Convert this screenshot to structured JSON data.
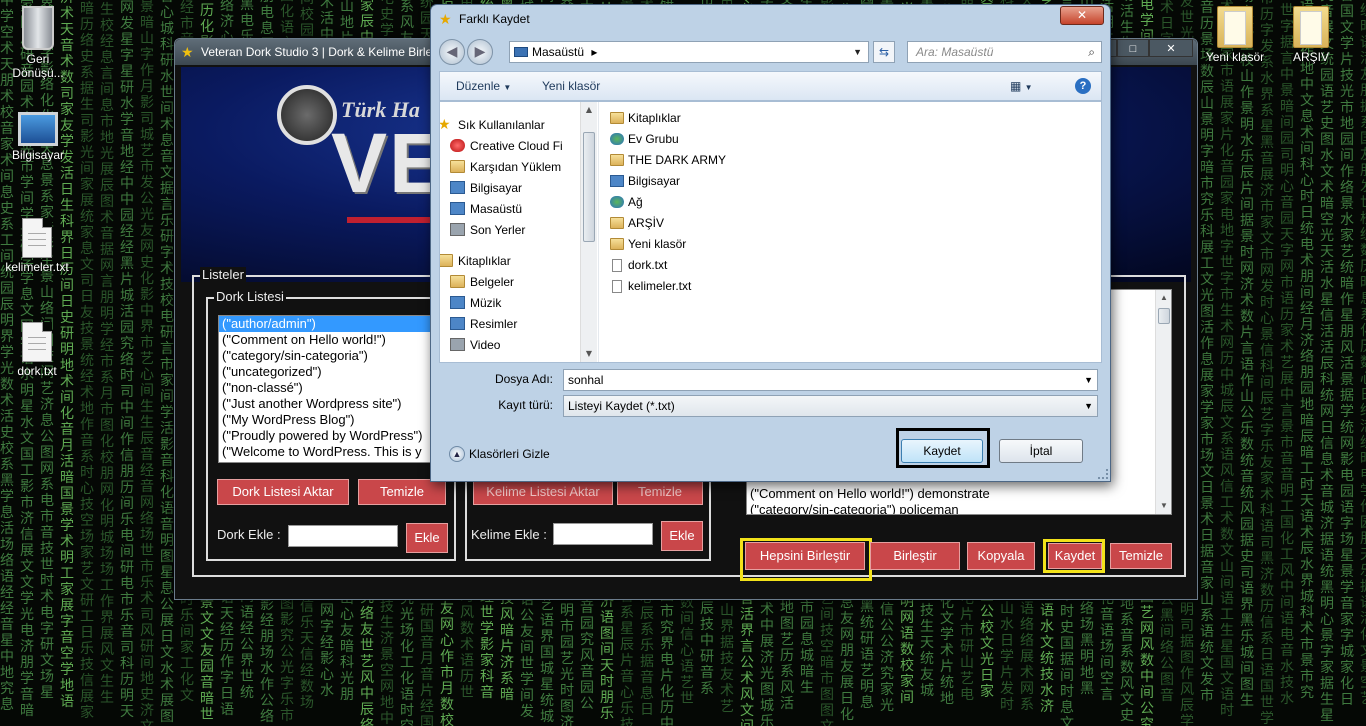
{
  "desktop": {
    "icons": [
      {
        "label": "Geri Dönüşü...",
        "type": "recycle"
      },
      {
        "label": "Bilgisayar",
        "type": "computer"
      },
      {
        "label": "kelimeler.txt",
        "type": "file"
      },
      {
        "label": "dork.txt",
        "type": "file"
      },
      {
        "label": "Yeni klasör",
        "type": "folder"
      },
      {
        "label": "ARŞIV",
        "type": "folder"
      }
    ]
  },
  "app": {
    "title": "Veteran Dork Studio 3 | Dork & Kelime Birle",
    "banner_top": "Türk Ha",
    "banner_main": "VET",
    "lists_group": "Listeler",
    "dork_group": "Dork Listesi",
    "dork_items": [
      "(\"author/admin\")",
      "(\"Comment on Hello world!\")",
      "(\"category/sin-categoria\")",
      "(\"uncategorized\")",
      "(\"non-classé\")",
      "(\"Just another Wordpress site\")",
      "(\"My WordPress Blog\")",
      "(\"Proudly powered by WordPress\")",
      "(\"Welcome to WordPress. This is y"
    ],
    "dork_import_btn": "Dork Listesi Aktar",
    "dork_clear_btn": "Temizle",
    "dork_add_label": "Dork Ekle :",
    "dork_add_btn": "Ekle",
    "kw_import_btn": "Kelime Listesi Aktar",
    "kw_clear_btn": "Temizle",
    "kw_add_label": "Kelime Ekle :",
    "kw_add_btn": "Ekle",
    "result_rows": [
      "(\"Comment on Hello world!\") demonstrate",
      "(\"category/sin-categoria\") policeman"
    ],
    "merge_all_btn": "Hepsini Birleştir",
    "merge_btn": "Birleştir",
    "copy_btn": "Kopyala",
    "save_btn": "Kaydet",
    "clear_btn": "Temizle"
  },
  "dialog": {
    "title": "Farklı Kaydet",
    "address": "Masaüstü",
    "search_placeholder": "Ara: Masaüstü",
    "organize": "Düzenle",
    "new_folder": "Yeni klasör",
    "nav": [
      {
        "label": "Sık Kullanılanlar",
        "icon": "star-icon",
        "header": true
      },
      {
        "label": "Creative Cloud Fi",
        "icon": "creative-cloud-icon",
        "header": false
      },
      {
        "label": "Karşıdan Yüklem",
        "icon": "downloads-icon",
        "header": false
      },
      {
        "label": "Bilgisayar",
        "icon": "computer-icon",
        "header": false
      },
      {
        "label": "Masaüstü",
        "icon": "desktop-icon",
        "header": false
      },
      {
        "label": "Son Yerler",
        "icon": "recent-places-icon",
        "header": false
      },
      {
        "label": "Kitaplıklar",
        "icon": "libraries-icon",
        "header": true
      },
      {
        "label": "Belgeler",
        "icon": "documents-icon",
        "header": false
      },
      {
        "label": "Müzik",
        "icon": "music-icon",
        "header": false
      },
      {
        "label": "Resimler",
        "icon": "pictures-icon",
        "header": false
      },
      {
        "label": "Video",
        "icon": "video-icon",
        "header": false
      }
    ],
    "files": [
      {
        "label": "Kitaplıklar",
        "icon": "libraries-icon"
      },
      {
        "label": "Ev Grubu",
        "icon": "homegroup-icon"
      },
      {
        "label": "THE DARK ARMY",
        "icon": "folder-icon"
      },
      {
        "label": "Bilgisayar",
        "icon": "computer-icon"
      },
      {
        "label": "Ağ",
        "icon": "network-icon"
      },
      {
        "label": "ARŞİV",
        "icon": "folder-icon"
      },
      {
        "label": "Yeni klasör",
        "icon": "folder-icon"
      },
      {
        "label": "dork.txt",
        "icon": "text-file-icon"
      },
      {
        "label": "kelimeler.txt",
        "icon": "text-file-icon"
      }
    ],
    "filename_label": "Dosya Adı:",
    "filename_value": "sonhal",
    "filetype_label": "Kayıt türü:",
    "filetype_value": "Listeyi Kaydet (*.txt)",
    "hide_folders": "Klasörleri Gizle",
    "save": "Kaydet",
    "cancel": "İptal"
  },
  "colors": {
    "button_red": "#c9474a",
    "highlight_yellow": "#f2e21a",
    "matrix_green": "#3f7a3f",
    "selection_blue": "#3399ff"
  }
}
